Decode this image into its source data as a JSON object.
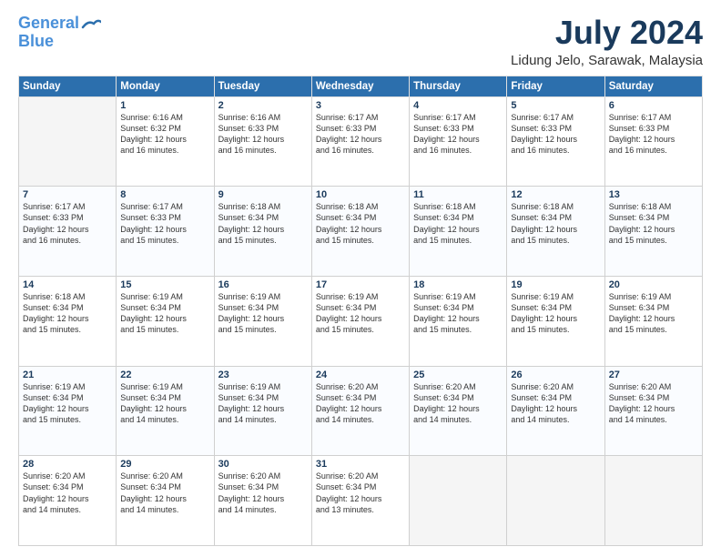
{
  "header": {
    "logo_line1": "General",
    "logo_line2": "Blue",
    "month": "July 2024",
    "location": "Lidung Jelo, Sarawak, Malaysia"
  },
  "weekdays": [
    "Sunday",
    "Monday",
    "Tuesday",
    "Wednesday",
    "Thursday",
    "Friday",
    "Saturday"
  ],
  "weeks": [
    [
      {
        "day": "",
        "info": ""
      },
      {
        "day": "1",
        "info": "Sunrise: 6:16 AM\nSunset: 6:32 PM\nDaylight: 12 hours\nand 16 minutes."
      },
      {
        "day": "2",
        "info": "Sunrise: 6:16 AM\nSunset: 6:33 PM\nDaylight: 12 hours\nand 16 minutes."
      },
      {
        "day": "3",
        "info": "Sunrise: 6:17 AM\nSunset: 6:33 PM\nDaylight: 12 hours\nand 16 minutes."
      },
      {
        "day": "4",
        "info": "Sunrise: 6:17 AM\nSunset: 6:33 PM\nDaylight: 12 hours\nand 16 minutes."
      },
      {
        "day": "5",
        "info": "Sunrise: 6:17 AM\nSunset: 6:33 PM\nDaylight: 12 hours\nand 16 minutes."
      },
      {
        "day": "6",
        "info": "Sunrise: 6:17 AM\nSunset: 6:33 PM\nDaylight: 12 hours\nand 16 minutes."
      }
    ],
    [
      {
        "day": "7",
        "info": "Sunrise: 6:17 AM\nSunset: 6:33 PM\nDaylight: 12 hours\nand 16 minutes."
      },
      {
        "day": "8",
        "info": "Sunrise: 6:17 AM\nSunset: 6:33 PM\nDaylight: 12 hours\nand 15 minutes."
      },
      {
        "day": "9",
        "info": "Sunrise: 6:18 AM\nSunset: 6:34 PM\nDaylight: 12 hours\nand 15 minutes."
      },
      {
        "day": "10",
        "info": "Sunrise: 6:18 AM\nSunset: 6:34 PM\nDaylight: 12 hours\nand 15 minutes."
      },
      {
        "day": "11",
        "info": "Sunrise: 6:18 AM\nSunset: 6:34 PM\nDaylight: 12 hours\nand 15 minutes."
      },
      {
        "day": "12",
        "info": "Sunrise: 6:18 AM\nSunset: 6:34 PM\nDaylight: 12 hours\nand 15 minutes."
      },
      {
        "day": "13",
        "info": "Sunrise: 6:18 AM\nSunset: 6:34 PM\nDaylight: 12 hours\nand 15 minutes."
      }
    ],
    [
      {
        "day": "14",
        "info": "Sunrise: 6:18 AM\nSunset: 6:34 PM\nDaylight: 12 hours\nand 15 minutes."
      },
      {
        "day": "15",
        "info": "Sunrise: 6:19 AM\nSunset: 6:34 PM\nDaylight: 12 hours\nand 15 minutes."
      },
      {
        "day": "16",
        "info": "Sunrise: 6:19 AM\nSunset: 6:34 PM\nDaylight: 12 hours\nand 15 minutes."
      },
      {
        "day": "17",
        "info": "Sunrise: 6:19 AM\nSunset: 6:34 PM\nDaylight: 12 hours\nand 15 minutes."
      },
      {
        "day": "18",
        "info": "Sunrise: 6:19 AM\nSunset: 6:34 PM\nDaylight: 12 hours\nand 15 minutes."
      },
      {
        "day": "19",
        "info": "Sunrise: 6:19 AM\nSunset: 6:34 PM\nDaylight: 12 hours\nand 15 minutes."
      },
      {
        "day": "20",
        "info": "Sunrise: 6:19 AM\nSunset: 6:34 PM\nDaylight: 12 hours\nand 15 minutes."
      }
    ],
    [
      {
        "day": "21",
        "info": "Sunrise: 6:19 AM\nSunset: 6:34 PM\nDaylight: 12 hours\nand 15 minutes."
      },
      {
        "day": "22",
        "info": "Sunrise: 6:19 AM\nSunset: 6:34 PM\nDaylight: 12 hours\nand 14 minutes."
      },
      {
        "day": "23",
        "info": "Sunrise: 6:19 AM\nSunset: 6:34 PM\nDaylight: 12 hours\nand 14 minutes."
      },
      {
        "day": "24",
        "info": "Sunrise: 6:20 AM\nSunset: 6:34 PM\nDaylight: 12 hours\nand 14 minutes."
      },
      {
        "day": "25",
        "info": "Sunrise: 6:20 AM\nSunset: 6:34 PM\nDaylight: 12 hours\nand 14 minutes."
      },
      {
        "day": "26",
        "info": "Sunrise: 6:20 AM\nSunset: 6:34 PM\nDaylight: 12 hours\nand 14 minutes."
      },
      {
        "day": "27",
        "info": "Sunrise: 6:20 AM\nSunset: 6:34 PM\nDaylight: 12 hours\nand 14 minutes."
      }
    ],
    [
      {
        "day": "28",
        "info": "Sunrise: 6:20 AM\nSunset: 6:34 PM\nDaylight: 12 hours\nand 14 minutes."
      },
      {
        "day": "29",
        "info": "Sunrise: 6:20 AM\nSunset: 6:34 PM\nDaylight: 12 hours\nand 14 minutes."
      },
      {
        "day": "30",
        "info": "Sunrise: 6:20 AM\nSunset: 6:34 PM\nDaylight: 12 hours\nand 14 minutes."
      },
      {
        "day": "31",
        "info": "Sunrise: 6:20 AM\nSunset: 6:34 PM\nDaylight: 12 hours\nand 13 minutes."
      },
      {
        "day": "",
        "info": ""
      },
      {
        "day": "",
        "info": ""
      },
      {
        "day": "",
        "info": ""
      }
    ]
  ]
}
